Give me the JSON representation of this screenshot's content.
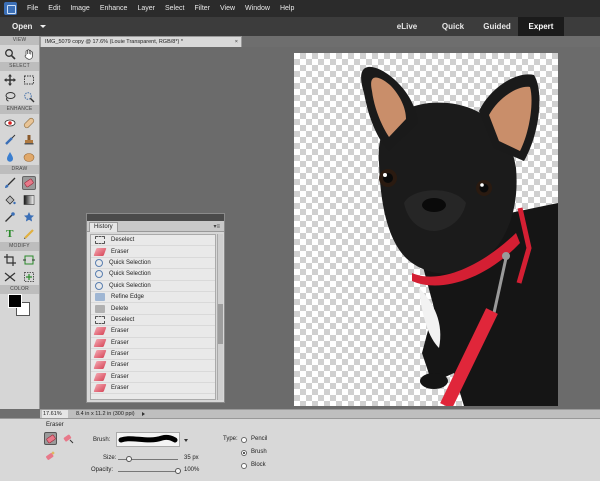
{
  "menubar": {
    "items": [
      "File",
      "Edit",
      "Image",
      "Enhance",
      "Layer",
      "Select",
      "Filter",
      "View",
      "Window",
      "Help"
    ]
  },
  "modebar": {
    "open_label": "Open",
    "modes": [
      "eLive",
      "Quick",
      "Guided",
      "Expert"
    ],
    "active_mode": "Expert"
  },
  "toolbox": {
    "sections": {
      "view": "VIEW",
      "select": "SELECT",
      "enhance": "ENHANCE",
      "draw": "DRAW",
      "modify": "MODIFY",
      "color": "COLOR"
    },
    "tools": [
      "zoom-icon",
      "hand-icon",
      "move-icon",
      "marquee-icon",
      "lasso-icon",
      "quick-selection-icon",
      "red-eye-icon",
      "spot-healing-icon",
      "smart-brush-icon",
      "clone-stamp-icon",
      "blur-icon",
      "sponge-icon",
      "brush-icon",
      "eraser-icon",
      "paint-bucket-icon",
      "gradient-icon",
      "eyedropper-icon",
      "custom-shape-icon",
      "type-icon",
      "pencil-icon",
      "crop-icon",
      "recompose-icon",
      "straighten-icon",
      "content-aware-move-icon"
    ],
    "active_tool": "eraser-icon",
    "colors": {
      "foreground": "#000000",
      "background": "#ffffff"
    }
  },
  "document": {
    "tab_title": "IMG_5079 copy @ 17.6% (Louie Transparent, RGB/8*) *",
    "close_label": "×"
  },
  "history": {
    "tab_label": "History",
    "items": [
      {
        "label": "Deselect",
        "icon": "deselect"
      },
      {
        "label": "Eraser",
        "icon": "eraser"
      },
      {
        "label": "Quick Selection",
        "icon": "quick"
      },
      {
        "label": "Quick Selection",
        "icon": "quick"
      },
      {
        "label": "Quick Selection",
        "icon": "quick"
      },
      {
        "label": "Refine Edge",
        "icon": "refine"
      },
      {
        "label": "Delete",
        "icon": "delete"
      },
      {
        "label": "Deselect",
        "icon": "deselect"
      },
      {
        "label": "Eraser",
        "icon": "eraser"
      },
      {
        "label": "Eraser",
        "icon": "eraser"
      },
      {
        "label": "Eraser",
        "icon": "eraser"
      },
      {
        "label": "Eraser",
        "icon": "eraser"
      },
      {
        "label": "Eraser",
        "icon": "eraser"
      },
      {
        "label": "Eraser",
        "icon": "eraser"
      }
    ]
  },
  "status": {
    "zoom": "17.61%",
    "doc_info": "8.4 in x 11.2 in (300 ppi)"
  },
  "options": {
    "tool_name": "Eraser",
    "brush_label": "Brush:",
    "size_label": "Size:",
    "size_value": "35 px",
    "size_level": 0.18,
    "opacity_label": "Opacity:",
    "opacity_value": "100%",
    "opacity_level": 1.0,
    "type_label": "Type:",
    "type_options": [
      "Pencil",
      "Brush",
      "Block"
    ],
    "type_selected": "Brush"
  },
  "theme": {
    "menubar_bg": "#2b2b2b",
    "active_mode_bg": "#1b1b1b",
    "dog_body": "#161616",
    "leash": "#e0263a"
  }
}
